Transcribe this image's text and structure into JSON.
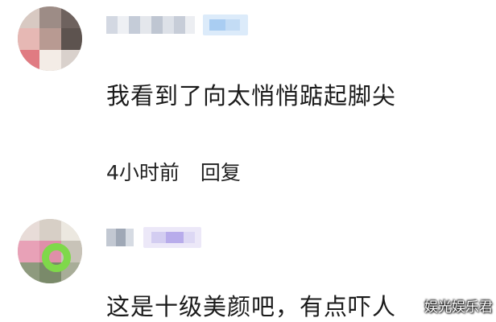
{
  "comments": [
    {
      "avatar": "avatar-blurred",
      "username": "",
      "text": "我看到了向太悄悄踮起脚尖",
      "time": "4小时前",
      "reply_label": "回复"
    },
    {
      "avatar": "avatar-blurred",
      "username": "",
      "text": "这是十级美颜吧，有点吓人"
    }
  ],
  "watermark": "娱光娱乐君"
}
